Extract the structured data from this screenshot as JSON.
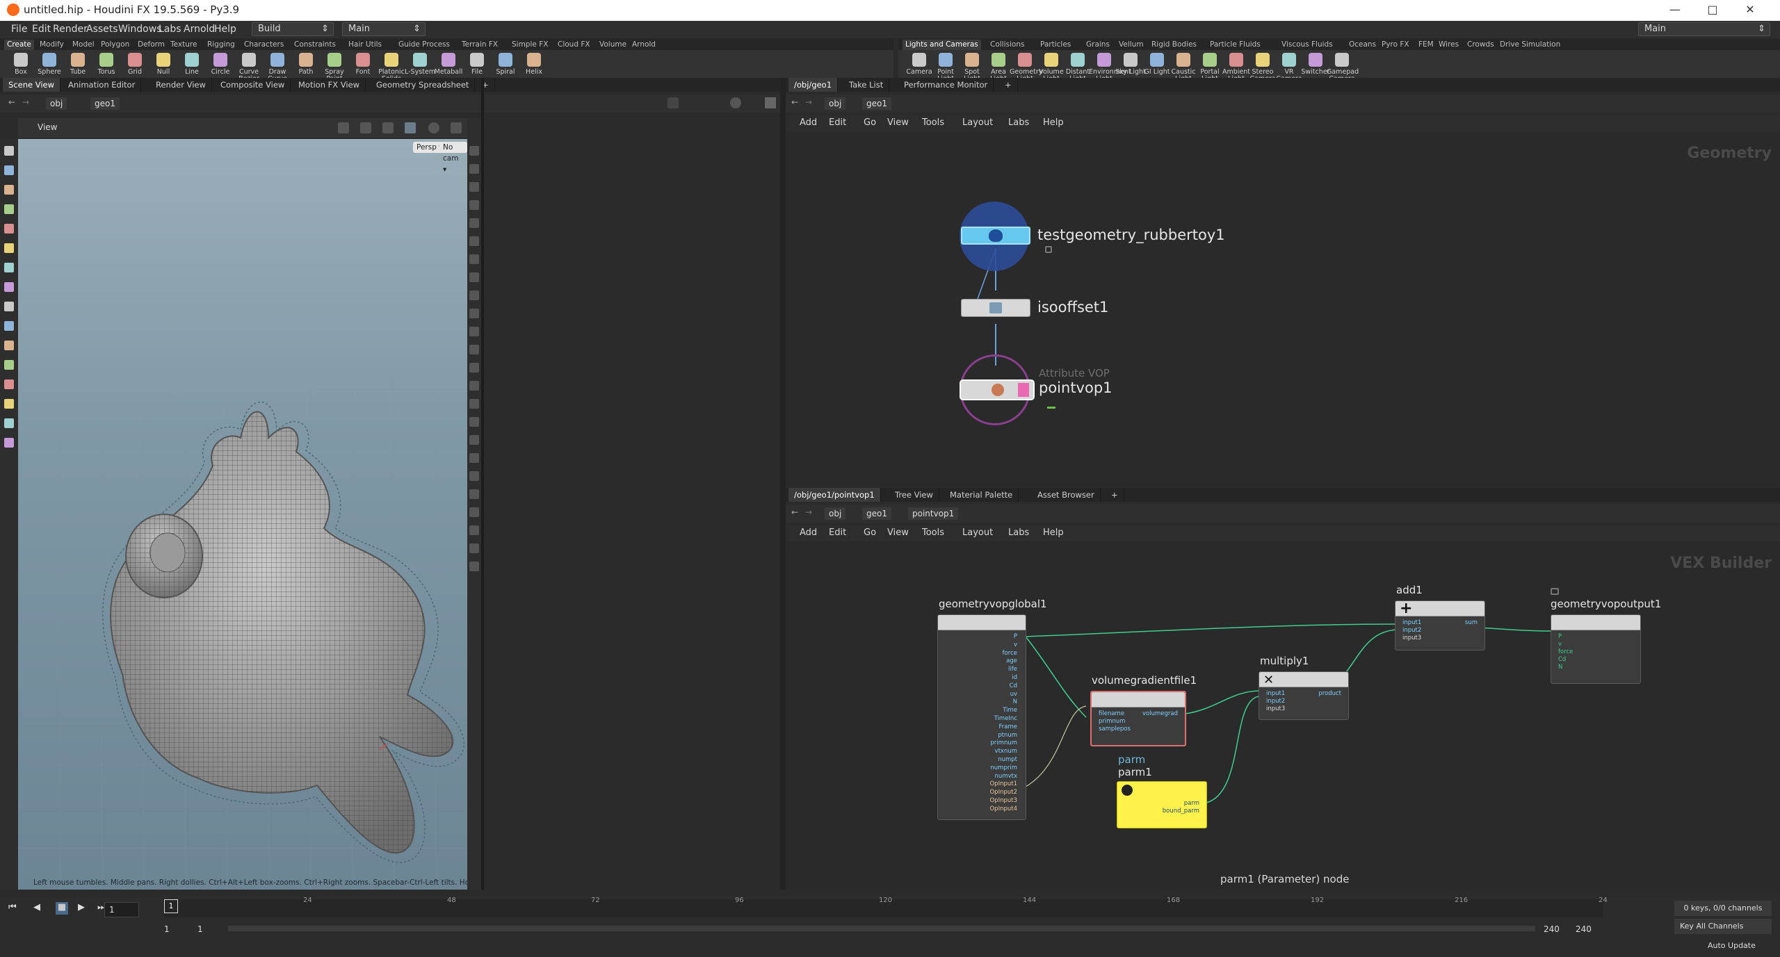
{
  "window": {
    "title": "untitled.hip - Houdini FX 19.5.569 - Py3.9",
    "main_desk": "Main"
  },
  "menu": [
    "File",
    "Edit",
    "Render",
    "Assets",
    "Windows",
    "Labs",
    "Arnold",
    "Help"
  ],
  "desktop_dd": {
    "build": "Build",
    "main": "Main"
  },
  "shelf_left": {
    "tabs": [
      "Create",
      "Modify",
      "Model",
      "Polygon",
      "Deform",
      "Texture",
      "Rigging",
      "Characters",
      "Constraints",
      "Hair Utils",
      "Guide Process",
      "Terrain FX",
      "Simple FX",
      "Cloud FX",
      "Volume",
      "Arnold"
    ],
    "tools": [
      "Box",
      "Sphere",
      "Tube",
      "Torus",
      "Grid",
      "Null",
      "Line",
      "Circle",
      "Curve Bezier",
      "Draw Curve",
      "Path",
      "Spray Paint",
      "Font",
      "Platonic Solids",
      "L-System",
      "Metaball",
      "File",
      "Spiral",
      "Helix"
    ]
  },
  "shelf_right": {
    "tabs": [
      "Lights and Cameras",
      "Collisions",
      "Particles",
      "Grains",
      "Vellum",
      "Rigid Bodies",
      "Particle Fluids",
      "Viscous Fluids",
      "Oceans",
      "Pyro FX",
      "FEM",
      "Wires",
      "Crowds",
      "Drive Simulation"
    ],
    "tools": [
      "Camera",
      "Point Light",
      "Spot Light",
      "Area Light",
      "Geometry Light",
      "Volume Light",
      "Distant Light",
      "Environment Light",
      "Sky Light",
      "GI Light",
      "Caustic Light",
      "Portal Light",
      "Ambient Light",
      "Stereo Camera",
      "VR Camera",
      "Switcher",
      "Gamepad Camera"
    ]
  },
  "left_pane": {
    "tabs": [
      "Scene View",
      "Animation Editor",
      "Render View",
      "Composite View",
      "Motion FX View",
      "Geometry Spreadsheet"
    ],
    "path": [
      "obj",
      "geo1"
    ],
    "view_label": "View",
    "persp": "Persp ▾",
    "cam": "No cam ▾",
    "hint": "Left mouse tumbles. Middle pans. Right dollies. Ctrl+Alt+Left box-zooms. Ctrl+Right zooms. Spacebar-Ctrl-Left tilts. Hold L for alternate tumble, dolly, and zoom.     M or Alt+M for First Person Navigation."
  },
  "network_top": {
    "tabs": [
      "/obj/geo1",
      "Take List",
      "Performance Monitor"
    ],
    "path": [
      "obj",
      "geo1"
    ],
    "menu": [
      "Add",
      "Edit",
      "Go",
      "View",
      "Tools",
      "Layout",
      "Labs",
      "Help"
    ],
    "context": "Geometry",
    "nodes": {
      "n1": "testgeometry_rubbertoy1",
      "n2": "isooffset1",
      "n3_type": "Attribute VOP",
      "n3": "pointvop1"
    }
  },
  "network_bottom": {
    "tabs": [
      "/obj/geo1/pointvop1",
      "Tree View",
      "Material Palette",
      "Asset Browser"
    ],
    "path": [
      "obj",
      "geo1",
      "pointvop1"
    ],
    "menu": [
      "Add",
      "Edit",
      "Go",
      "View",
      "Tools",
      "Layout",
      "Labs",
      "Help"
    ],
    "context": "VEX Builder",
    "status": "parm1 (Parameter) node",
    "nodes": {
      "global": {
        "name": "geometryvopglobal1",
        "outputs": [
          "P",
          "v",
          "force",
          "age",
          "life",
          "id",
          "Cd",
          "uv",
          "N",
          "Time",
          "TimeInc",
          "Frame",
          "ptnum",
          "primnum",
          "vtxnum",
          "numpt",
          "numprim",
          "numvtx",
          "OpInput1",
          "OpInput2",
          "OpInput3",
          "OpInput4"
        ]
      },
      "volgrad": {
        "name": "volumegradientfile1",
        "inputs": [
          "filename",
          "primnum",
          "samplepos"
        ],
        "output": "volumegrad"
      },
      "multiply": {
        "name": "multiply1",
        "inputs": [
          "input1",
          "input2",
          "input3"
        ],
        "output": "product"
      },
      "add": {
        "name": "add1",
        "inputs": [
          "input1",
          "input2",
          "input3"
        ],
        "output": "sum"
      },
      "output": {
        "name": "geometryvopoutput1",
        "inputs": [
          "P",
          "v",
          "force",
          "Cd",
          "N"
        ]
      },
      "parm": {
        "type": "parm",
        "name": "parm1",
        "outputs": [
          "parm",
          "bound_parm"
        ]
      }
    }
  },
  "timeline": {
    "frame": "1",
    "ticks": [
      "24",
      "48",
      "72",
      "96",
      "120",
      "144",
      "168",
      "192",
      "216",
      "24"
    ],
    "range_start": "1",
    "range_start2": "1",
    "range_end": "240",
    "range_end2": "240",
    "keys": "0 keys, 0/0 channels",
    "key_all": "Key All Channels",
    "auto_update": "Auto Update",
    "playhead": "1"
  }
}
